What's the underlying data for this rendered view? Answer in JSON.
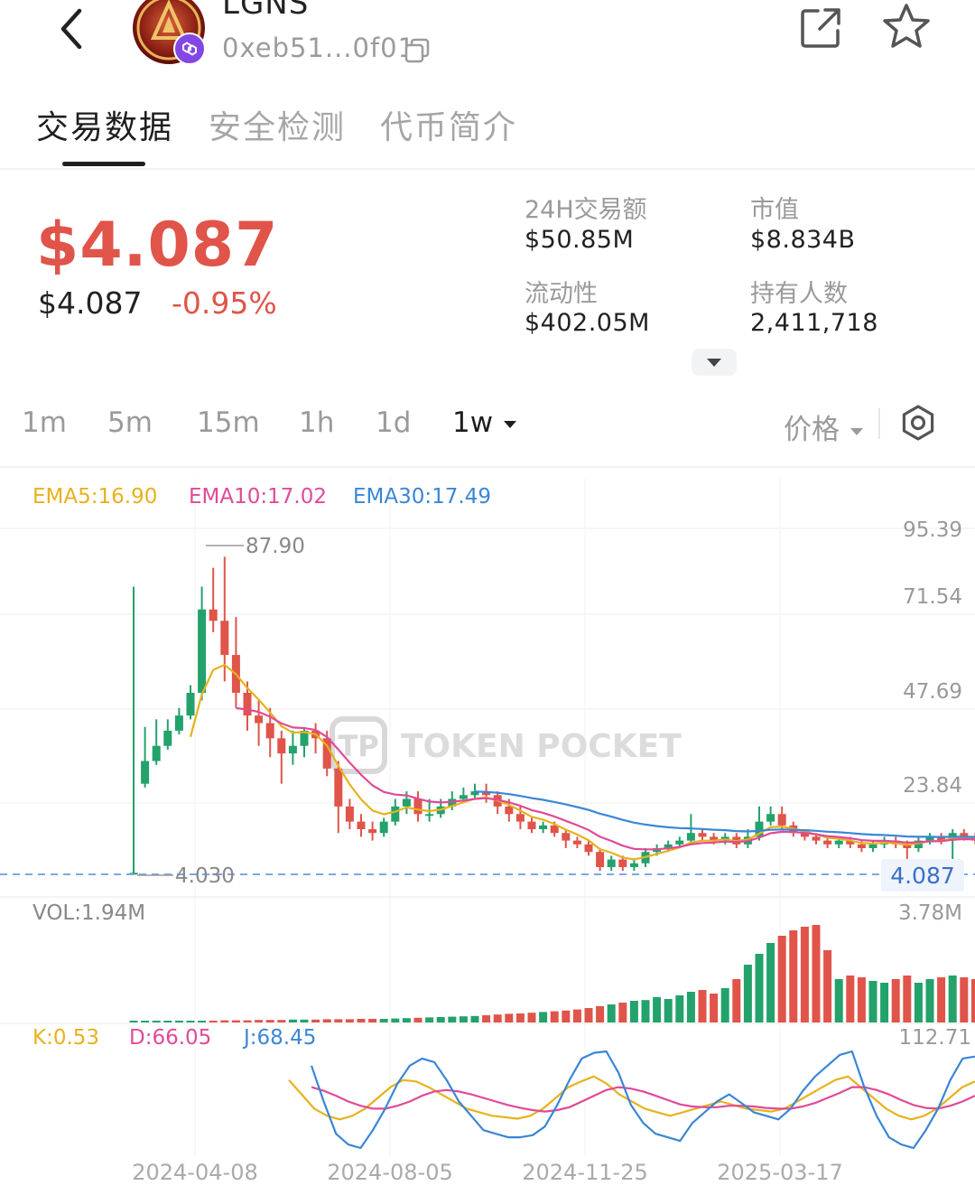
{
  "header": {
    "token_name": "LGNS",
    "address": "0xeb51...0f01"
  },
  "tabs": [
    {
      "label": "交易数据",
      "active": true
    },
    {
      "label": "安全检测",
      "active": false
    },
    {
      "label": "代币简介",
      "active": false
    }
  ],
  "price": {
    "big": "$4.087",
    "sub": "$4.087",
    "change": "-0.95%"
  },
  "stats": {
    "volume_24h_label": "24H交易额",
    "volume_24h_value": "$50.85M",
    "market_cap_label": "市值",
    "market_cap_value": "$8.834B",
    "liquidity_label": "流动性",
    "liquidity_value": "$402.05M",
    "holders_label": "持有人数",
    "holders_value": "2,411,718"
  },
  "intervals": [
    {
      "label": "1m",
      "active": false
    },
    {
      "label": "5m",
      "active": false
    },
    {
      "label": "15m",
      "active": false
    },
    {
      "label": "1h",
      "active": false
    },
    {
      "label": "1d",
      "active": false
    },
    {
      "label": "1w",
      "active": true
    }
  ],
  "price_mode_label": "价格",
  "watermark": "TOKEN POCKET",
  "colors": {
    "up": "#23a26b",
    "down": "#e0544a",
    "ema5": "#e7b21d",
    "ema10": "#e04a98",
    "ema30": "#3a86d6",
    "k": "#e7b21d",
    "d": "#e04a98",
    "j": "#3a86d6"
  },
  "chart_data": {
    "type": "candlestick",
    "interval": "1w",
    "indicators": {
      "ema5_label": "EMA5:16.90",
      "ema10_label": "EMA10:17.02",
      "ema30_label": "EMA30:17.49"
    },
    "y_ticks": [
      "95.39",
      "71.54",
      "47.69",
      "23.84"
    ],
    "y_tick_values": [
      95.39,
      71.54,
      47.69,
      23.84
    ],
    "high_marker": "87.90",
    "low_marker": "4.030",
    "current_price": "4.087",
    "current_price_value": 4.087,
    "volume_label": "VOL:1.94M",
    "volume_max_label": "3.78M",
    "kdj": {
      "k_label": "K:0.53",
      "d_label": "D:66.05",
      "j_label": "J:68.45",
      "max_label": "112.71"
    },
    "x_labels": [
      "2024-04-08",
      "2024-08-05",
      "2024-11-25",
      "2025-03-17"
    ],
    "candles": [
      [
        4.03,
        4.5,
        80,
        4.03
      ],
      [
        28,
        34,
        43,
        27
      ],
      [
        34,
        38,
        45,
        33
      ],
      [
        38,
        42,
        45,
        37
      ],
      [
        42,
        46,
        48,
        41
      ],
      [
        46,
        52,
        54,
        45
      ],
      [
        52,
        74,
        80,
        50
      ],
      [
        74,
        71,
        85,
        68
      ],
      [
        71,
        62,
        87.9,
        55
      ],
      [
        62,
        52,
        72,
        48
      ],
      [
        52,
        46,
        55,
        42
      ],
      [
        46,
        44,
        50,
        38
      ],
      [
        44,
        40,
        48,
        35
      ],
      [
        40,
        36,
        42,
        28
      ],
      [
        36,
        38,
        42,
        33
      ],
      [
        38,
        42,
        43,
        35
      ],
      [
        42,
        40,
        44,
        36
      ],
      [
        40,
        32,
        42,
        30
      ],
      [
        32,
        22,
        34,
        15
      ],
      [
        22,
        18,
        24,
        16
      ],
      [
        18,
        16,
        20,
        14
      ],
      [
        16,
        15,
        18,
        13
      ],
      [
        15,
        18,
        19,
        14
      ],
      [
        18,
        22,
        24,
        17
      ],
      [
        22,
        24,
        26,
        20
      ],
      [
        24,
        20,
        26,
        18
      ],
      [
        20,
        20,
        24,
        18
      ],
      [
        20,
        22,
        24,
        19
      ],
      [
        22,
        24,
        26,
        21
      ],
      [
        24,
        25,
        27,
        23
      ],
      [
        25,
        26,
        28,
        24
      ],
      [
        26,
        25,
        28,
        23
      ],
      [
        25,
        22,
        26,
        20
      ],
      [
        22,
        20,
        24,
        18
      ],
      [
        20,
        18,
        22,
        16
      ],
      [
        18,
        16,
        19,
        15
      ],
      [
        16,
        17,
        18,
        15
      ],
      [
        17,
        15,
        18,
        14
      ],
      [
        15,
        13,
        16,
        11
      ],
      [
        13,
        12,
        14,
        11
      ],
      [
        12,
        10,
        13,
        9
      ],
      [
        10,
        6,
        11,
        5
      ],
      [
        6,
        8,
        9,
        5
      ],
      [
        8,
        6,
        9,
        5
      ],
      [
        6,
        7,
        8,
        5
      ],
      [
        7,
        10,
        11,
        6
      ],
      [
        10,
        11,
        12,
        9
      ],
      [
        11,
        12,
        13,
        10
      ],
      [
        12,
        13,
        14,
        11
      ],
      [
        13,
        15,
        20,
        12
      ],
      [
        15,
        14,
        16,
        13
      ],
      [
        14,
        13,
        15,
        12
      ],
      [
        13,
        14,
        15,
        12
      ],
      [
        14,
        12,
        15,
        11
      ],
      [
        12,
        14,
        16,
        11
      ],
      [
        14,
        18,
        22,
        13
      ],
      [
        18,
        20,
        22,
        17
      ],
      [
        20,
        17,
        22,
        16
      ],
      [
        17,
        15,
        18,
        14
      ],
      [
        15,
        14,
        16,
        13
      ],
      [
        14,
        13,
        15,
        12
      ],
      [
        13,
        12,
        14,
        11
      ],
      [
        12,
        13,
        14,
        11
      ],
      [
        13,
        12,
        14,
        11
      ],
      [
        12,
        11,
        13,
        10
      ],
      [
        11,
        12,
        13,
        10
      ],
      [
        12,
        13,
        14,
        11
      ],
      [
        13,
        12,
        14,
        11
      ],
      [
        12,
        11,
        13,
        8
      ],
      [
        11,
        13,
        14,
        10
      ],
      [
        13,
        14,
        15,
        12
      ],
      [
        14,
        13,
        15,
        12
      ],
      [
        13,
        15,
        16,
        6
      ],
      [
        15,
        14,
        16,
        13
      ],
      [
        14,
        13,
        15,
        12
      ]
    ],
    "volumes": [
      0.03,
      0.03,
      0.03,
      0.03,
      0.04,
      0.04,
      0.04,
      0.05,
      0.06,
      0.06,
      0.06,
      0.07,
      0.07,
      0.07,
      0.08,
      0.08,
      0.08,
      0.09,
      0.09,
      0.09,
      0.1,
      0.1,
      0.1,
      0.11,
      0.12,
      0.13,
      0.14,
      0.15,
      0.16,
      0.17,
      0.18,
      0.2,
      0.22,
      0.24,
      0.25,
      0.27,
      0.29,
      0.31,
      0.33,
      0.36,
      0.4,
      0.45,
      0.5,
      0.55,
      0.6,
      0.62,
      0.7,
      0.65,
      0.75,
      0.85,
      0.9,
      0.8,
      0.95,
      1.2,
      1.6,
      1.9,
      2.2,
      2.4,
      2.55,
      2.65,
      2.7,
      2.0,
      1.2,
      1.3,
      1.25,
      1.15,
      1.1,
      1.2,
      1.3,
      1.1,
      1.2,
      1.25,
      1.3,
      1.25,
      1.2
    ],
    "kdj_k": [
      80,
      60,
      40,
      30,
      25,
      30,
      40,
      55,
      70,
      80,
      78,
      70,
      60,
      50,
      40,
      35,
      30,
      28,
      26,
      30,
      40,
      55,
      70,
      78,
      85,
      75,
      60,
      50,
      40,
      35,
      30,
      35,
      40,
      45,
      50,
      45,
      40,
      38,
      36,
      40,
      50,
      60,
      70,
      80,
      85,
      70,
      55,
      40,
      30,
      25,
      30,
      40,
      55,
      70,
      78
    ],
    "kdj_d": [
      70,
      65,
      58,
      50,
      44,
      40,
      40,
      44,
      50,
      58,
      64,
      66,
      64,
      60,
      55,
      50,
      45,
      41,
      38,
      36,
      38,
      42,
      50,
      58,
      66,
      70,
      68,
      64,
      58,
      52,
      46,
      43,
      42,
      42,
      44,
      44,
      43,
      41,
      40,
      40,
      43,
      48,
      55,
      62,
      70,
      70,
      66,
      60,
      52,
      45,
      41,
      40,
      44,
      50,
      58
    ],
    "kdj_j": [
      100,
      50,
      5,
      -10,
      -15,
      10,
      40,
      75,
      100,
      110,
      105,
      80,
      50,
      30,
      10,
      5,
      0,
      0,
      3,
      15,
      45,
      80,
      110,
      118,
      120,
      90,
      45,
      20,
      5,
      0,
      -5,
      20,
      35,
      50,
      60,
      48,
      35,
      30,
      25,
      40,
      65,
      85,
      100,
      115,
      120,
      70,
      30,
      0,
      -10,
      -15,
      10,
      40,
      80,
      110,
      112.71
    ]
  }
}
